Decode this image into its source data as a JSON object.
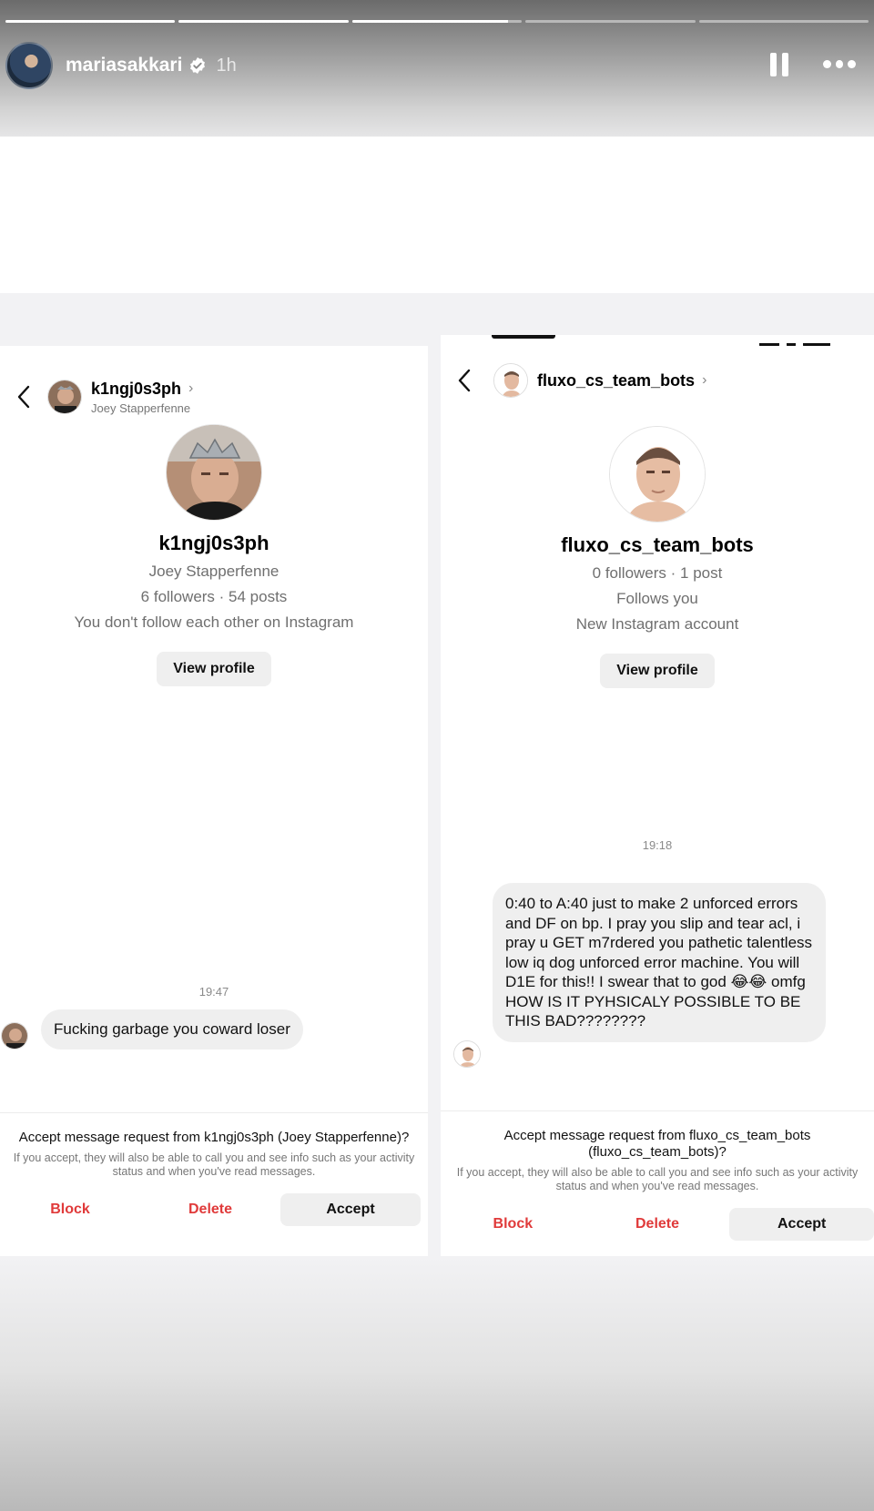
{
  "story": {
    "username": "mariasakkari",
    "time": "1h",
    "progress": [
      1,
      1,
      0.92,
      0,
      0
    ],
    "pause_icon": "pause-icon",
    "more_icon": "more-icon",
    "verified_icon": "verified-icon"
  },
  "left_chat": {
    "header_username": "k1ngj0s3ph",
    "header_subtitle": "Joey Stapperfenne",
    "header_chevron": "›",
    "profile_name": "k1ngj0s3ph",
    "profile_fullname": "Joey Stapperfenne",
    "profile_stats": "6 followers · 54 posts",
    "profile_relation": "You don't follow each other on Instagram",
    "view_profile": "View profile",
    "message_time": "19:47",
    "message_text": "Fucking garbage you coward loser",
    "accept_title": "Accept message request from k1ngj0s3ph (Joey Stapperfenne)?",
    "accept_desc": "If you accept, they will also be able to call you and see info such as your activity status and when you've read messages.",
    "block": "Block",
    "delete": "Delete",
    "accept": "Accept"
  },
  "right_chat": {
    "header_username": "fluxo_cs_team_bots",
    "header_chevron": "›",
    "profile_name": "fluxo_cs_team_bots",
    "profile_stats": "0 followers · 1 post",
    "profile_follows": "Follows you",
    "profile_new": "New Instagram account",
    "view_profile": "View profile",
    "message_time": "19:18",
    "message_text": "0:40 to A:40 just to make 2 unforced errors and DF on bp. I pray you slip and tear acl, i pray u GET m7rdered you pathetic talentless low iq dog unforced error machine. You will D1E for this!! I swear that to god 😂😂 omfg HOW IS IT PYHSICALY POSSIBLE TO BE THIS BAD????????",
    "accept_title": "Accept message request from fluxo_cs_team_bots (fluxo_cs_team_bots)?",
    "accept_desc": "If you accept, they will also be able to call you and see info such as your activity status and when you've read messages.",
    "block": "Block",
    "delete": "Delete",
    "accept": "Accept"
  },
  "colors": {
    "danger": "#e03a3a",
    "bubble": "#efefef",
    "muted": "#777777"
  }
}
